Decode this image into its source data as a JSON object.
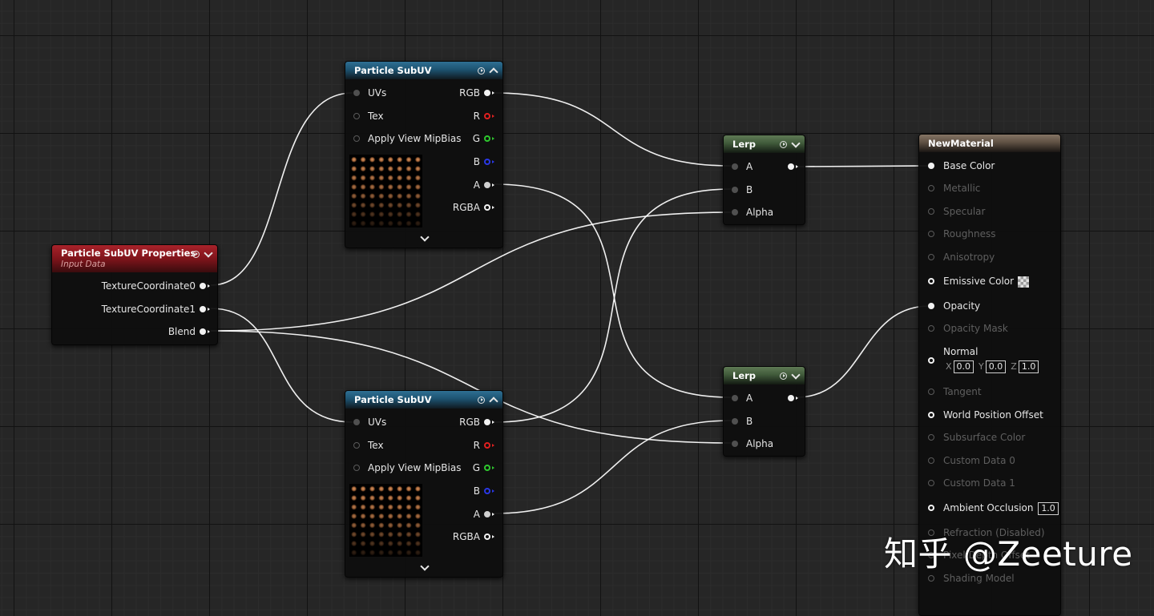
{
  "nodes": {
    "props": {
      "title": "Particle SubUV Properties",
      "subtitle": "Input Data",
      "outputs": [
        "TextureCoordinate0",
        "TextureCoordinate1",
        "Blend"
      ]
    },
    "subuv_top": {
      "title": "Particle SubUV",
      "inputs": [
        "UVs",
        "Tex",
        "Apply View MipBias"
      ],
      "outputs": [
        "RGB",
        "R",
        "G",
        "B",
        "A",
        "RGBA"
      ]
    },
    "subuv_bottom": {
      "title": "Particle SubUV",
      "inputs": [
        "UVs",
        "Tex",
        "Apply View MipBias"
      ],
      "outputs": [
        "RGB",
        "R",
        "G",
        "B",
        "A",
        "RGBA"
      ]
    },
    "lerp_top": {
      "title": "Lerp",
      "inputs": [
        "A",
        "B",
        "Alpha"
      ]
    },
    "lerp_bottom": {
      "title": "Lerp",
      "inputs": [
        "A",
        "B",
        "Alpha"
      ]
    },
    "material": {
      "title": "NewMaterial",
      "pins": [
        {
          "label": "Base Color",
          "state": "connected"
        },
        {
          "label": "Metallic",
          "state": "disabled"
        },
        {
          "label": "Specular",
          "state": "disabled"
        },
        {
          "label": "Roughness",
          "state": "disabled"
        },
        {
          "label": "Anisotropy",
          "state": "disabled"
        },
        {
          "label": "Emissive Color",
          "state": "enabled"
        },
        {
          "label": "Opacity",
          "state": "connected"
        },
        {
          "label": "Opacity Mask",
          "state": "disabled"
        },
        {
          "label": "Normal",
          "state": "enabled"
        },
        {
          "label": "Tangent",
          "state": "disabled"
        },
        {
          "label": "World Position Offset",
          "state": "enabled"
        },
        {
          "label": "Subsurface Color",
          "state": "disabled"
        },
        {
          "label": "Custom Data 0",
          "state": "disabled"
        },
        {
          "label": "Custom Data 1",
          "state": "disabled"
        },
        {
          "label": "Ambient Occlusion",
          "state": "enabled"
        },
        {
          "label": "Refraction (Disabled)",
          "state": "disabled"
        },
        {
          "label": "Pixel Depth Offset",
          "state": "disabled"
        },
        {
          "label": "Shading Model",
          "state": "disabled"
        }
      ],
      "normal_default": {
        "x_label": "X",
        "x": "0.0",
        "y_label": "Y",
        "y": "0.0",
        "z_label": "Z",
        "z": "1.0"
      },
      "ao_default": "1.0"
    }
  },
  "watermark": "知乎 @Zeeture",
  "colors": {
    "header_blue": "#1d5371",
    "header_green": "#405a3a",
    "header_brown": "#5e5043",
    "header_red": "#7f141b",
    "pin_r": "#e02020",
    "pin_g": "#2ec82e",
    "pin_b": "#2a38e6",
    "wire": "#ffffff"
  }
}
